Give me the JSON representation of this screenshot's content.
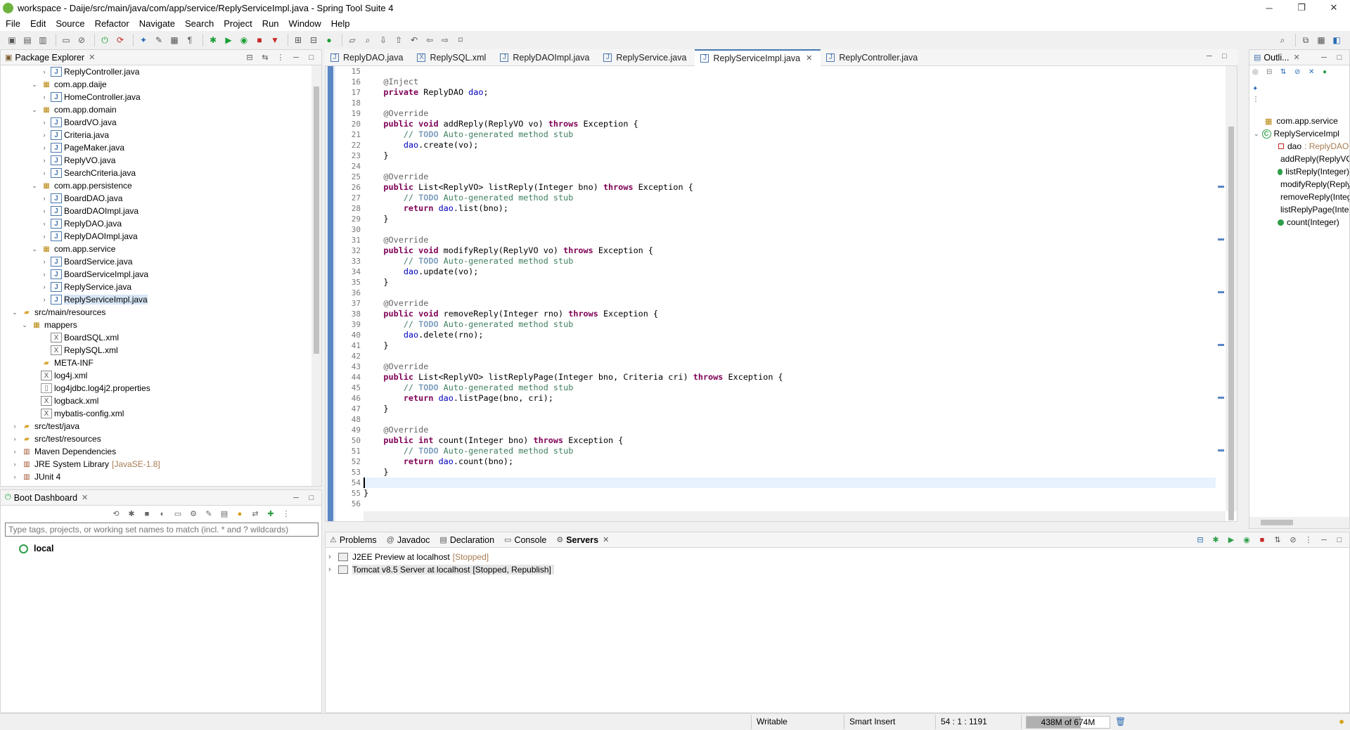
{
  "window": {
    "title": "workspace - Daije/src/main/java/com/app/service/ReplyServiceImpl.java - Spring Tool Suite 4",
    "minimize": "─",
    "maximize": "❐",
    "close": "✕"
  },
  "menu": [
    "File",
    "Edit",
    "Source",
    "Refactor",
    "Navigate",
    "Search",
    "Project",
    "Run",
    "Window",
    "Help"
  ],
  "package_explorer": {
    "title": "Package Explorer",
    "items": [
      {
        "indent": 4,
        "twisty": "›",
        "icon": "java",
        "label": "ReplyController.java"
      },
      {
        "indent": 3,
        "twisty": "⌄",
        "icon": "pkg",
        "label": "com.app.daije"
      },
      {
        "indent": 4,
        "twisty": "›",
        "icon": "java",
        "label": "HomeController.java"
      },
      {
        "indent": 3,
        "twisty": "⌄",
        "icon": "pkg",
        "label": "com.app.domain"
      },
      {
        "indent": 4,
        "twisty": "›",
        "icon": "java",
        "label": "BoardVO.java"
      },
      {
        "indent": 4,
        "twisty": "›",
        "icon": "java",
        "label": "Criteria.java"
      },
      {
        "indent": 4,
        "twisty": "›",
        "icon": "java",
        "label": "PageMaker.java"
      },
      {
        "indent": 4,
        "twisty": "›",
        "icon": "java",
        "label": "ReplyVO.java"
      },
      {
        "indent": 4,
        "twisty": "›",
        "icon": "java",
        "label": "SearchCriteria.java"
      },
      {
        "indent": 3,
        "twisty": "⌄",
        "icon": "pkg",
        "label": "com.app.persistence"
      },
      {
        "indent": 4,
        "twisty": "›",
        "icon": "java",
        "label": "BoardDAO.java"
      },
      {
        "indent": 4,
        "twisty": "›",
        "icon": "java",
        "label": "BoardDAOImpl.java"
      },
      {
        "indent": 4,
        "twisty": "›",
        "icon": "java",
        "label": "ReplyDAO.java"
      },
      {
        "indent": 4,
        "twisty": "›",
        "icon": "java",
        "label": "ReplyDAOImpl.java"
      },
      {
        "indent": 3,
        "twisty": "⌄",
        "icon": "pkg",
        "label": "com.app.service"
      },
      {
        "indent": 4,
        "twisty": "›",
        "icon": "java",
        "label": "BoardService.java"
      },
      {
        "indent": 4,
        "twisty": "›",
        "icon": "java",
        "label": "BoardServiceImpl.java"
      },
      {
        "indent": 4,
        "twisty": "›",
        "icon": "java",
        "label": "ReplyService.java"
      },
      {
        "indent": 4,
        "twisty": "›",
        "icon": "java",
        "label": "ReplyServiceImpl.java",
        "selected": true
      },
      {
        "indent": 1,
        "twisty": "⌄",
        "icon": "folder",
        "label": "src/main/resources"
      },
      {
        "indent": 2,
        "twisty": "⌄",
        "icon": "pkg",
        "label": "mappers"
      },
      {
        "indent": 4,
        "twisty": "",
        "icon": "xml",
        "label": "BoardSQL.xml"
      },
      {
        "indent": 4,
        "twisty": "",
        "icon": "xml",
        "label": "ReplySQL.xml"
      },
      {
        "indent": 3,
        "twisty": "",
        "icon": "folder",
        "label": "META-INF"
      },
      {
        "indent": 3,
        "twisty": "",
        "icon": "xml",
        "label": "log4j.xml"
      },
      {
        "indent": 3,
        "twisty": "",
        "icon": "file",
        "label": "log4jdbc.log4j2.properties"
      },
      {
        "indent": 3,
        "twisty": "",
        "icon": "xml",
        "label": "logback.xml"
      },
      {
        "indent": 3,
        "twisty": "",
        "icon": "xml",
        "label": "mybatis-config.xml"
      },
      {
        "indent": 1,
        "twisty": "›",
        "icon": "folder",
        "label": "src/test/java"
      },
      {
        "indent": 1,
        "twisty": "›",
        "icon": "folder",
        "label": "src/test/resources"
      },
      {
        "indent": 1,
        "twisty": "›",
        "icon": "lib",
        "label": "Maven Dependencies"
      },
      {
        "indent": 1,
        "twisty": "›",
        "icon": "lib",
        "label": "JRE System Library",
        "decoration": "[JavaSE-1.8]"
      },
      {
        "indent": 1,
        "twisty": "›",
        "icon": "lib",
        "label": "JUnit 4"
      }
    ]
  },
  "editor_tabs": [
    {
      "label": "ReplyDAO.java",
      "type": "java"
    },
    {
      "label": "ReplySQL.xml",
      "type": "xml"
    },
    {
      "label": "ReplyDAOImpl.java",
      "type": "java"
    },
    {
      "label": "ReplyService.java",
      "type": "java"
    },
    {
      "label": "ReplyServiceImpl.java",
      "type": "java",
      "active": true
    },
    {
      "label": "ReplyController.java",
      "type": "java"
    }
  ],
  "editor": {
    "lines": [
      {
        "n": "15",
        "html": ""
      },
      {
        "n": "16",
        "fold": true,
        "html": "    <span class='ann'>@Inject</span>"
      },
      {
        "n": "17",
        "html": "    <span class='kw'>private</span> ReplyDAO <span class='fld'>dao</span>;"
      },
      {
        "n": "18",
        "html": ""
      },
      {
        "n": "19",
        "fold": true,
        "html": "    <span class='ann'>@Override</span>"
      },
      {
        "n": "20",
        "html": "    <span class='kw'>public void</span> addReply(ReplyVO vo) <span class='kw'>throws</span> Exception {"
      },
      {
        "n": "21",
        "html": "        <span class='cmt'>// <span class='todo'>TODO</span> Auto-generated method stub</span>"
      },
      {
        "n": "22",
        "html": "        <span class='fld'>dao</span>.create(vo);"
      },
      {
        "n": "23",
        "html": "    }"
      },
      {
        "n": "24",
        "html": ""
      },
      {
        "n": "25",
        "fold": true,
        "html": "    <span class='ann'>@Override</span>"
      },
      {
        "n": "26",
        "html": "    <span class='kw'>public</span> List&lt;ReplyVO&gt; listReply(Integer bno) <span class='kw'>throws</span> Exception {"
      },
      {
        "n": "27",
        "html": "        <span class='cmt'>// <span class='todo'>TODO</span> Auto-generated method stub</span>"
      },
      {
        "n": "28",
        "html": "        <span class='kw'>return</span> <span class='fld'>dao</span>.list(bno);"
      },
      {
        "n": "29",
        "html": "    }"
      },
      {
        "n": "30",
        "html": ""
      },
      {
        "n": "31",
        "fold": true,
        "html": "    <span class='ann'>@Override</span>"
      },
      {
        "n": "32",
        "html": "    <span class='kw'>public void</span> modifyReply(ReplyVO vo) <span class='kw'>throws</span> Exception {"
      },
      {
        "n": "33",
        "html": "        <span class='cmt'>// <span class='todo'>TODO</span> Auto-generated method stub</span>"
      },
      {
        "n": "34",
        "html": "        <span class='fld'>dao</span>.update(vo);"
      },
      {
        "n": "35",
        "html": "    }"
      },
      {
        "n": "36",
        "html": ""
      },
      {
        "n": "37",
        "fold": true,
        "html": "    <span class='ann'>@Override</span>"
      },
      {
        "n": "38",
        "html": "    <span class='kw'>public void</span> removeReply(Integer rno) <span class='kw'>throws</span> Exception {"
      },
      {
        "n": "39",
        "html": "        <span class='cmt'>// <span class='todo'>TODO</span> Auto-generated method stub</span>"
      },
      {
        "n": "40",
        "html": "        <span class='fld'>dao</span>.delete(rno);"
      },
      {
        "n": "41",
        "html": "    }"
      },
      {
        "n": "42",
        "html": ""
      },
      {
        "n": "43",
        "fold": true,
        "html": "    <span class='ann'>@Override</span>"
      },
      {
        "n": "44",
        "html": "    <span class='kw'>public</span> List&lt;ReplyVO&gt; listReplyPage(Integer bno, Criteria cri) <span class='kw'>throws</span> Exception {"
      },
      {
        "n": "45",
        "html": "        <span class='cmt'>// <span class='todo'>TODO</span> Auto-generated method stub</span>"
      },
      {
        "n": "46",
        "html": "        <span class='kw'>return</span> <span class='fld'>dao</span>.listPage(bno, cri);"
      },
      {
        "n": "47",
        "html": "    }"
      },
      {
        "n": "48",
        "html": ""
      },
      {
        "n": "49",
        "fold": true,
        "html": "    <span class='ann'>@Override</span>"
      },
      {
        "n": "50",
        "html": "    <span class='kw'>public int</span> count(Integer bno) <span class='kw'>throws</span> Exception {"
      },
      {
        "n": "51",
        "html": "        <span class='cmt'>// <span class='todo'>TODO</span> Auto-generated method stub</span>"
      },
      {
        "n": "52",
        "html": "        <span class='kw'>return</span> <span class='fld'>dao</span>.count(bno);"
      },
      {
        "n": "53",
        "html": "    }"
      },
      {
        "n": "54",
        "current": true,
        "html": ""
      },
      {
        "n": "55",
        "html": "}"
      },
      {
        "n": "56",
        "html": ""
      }
    ]
  },
  "outline": {
    "title": "Outli...",
    "items": [
      {
        "kind": "pkg",
        "label": "com.app.service"
      },
      {
        "kind": "class",
        "label": "ReplyServiceImpl"
      },
      {
        "kind": "field",
        "label": "dao",
        "type": ": ReplyDAO"
      },
      {
        "kind": "method",
        "label": "addReply(ReplyVO)"
      },
      {
        "kind": "method",
        "label": "listReply(Integer)"
      },
      {
        "kind": "method",
        "label": "modifyReply(ReplyVO)"
      },
      {
        "kind": "method",
        "label": "removeReply(Integer)"
      },
      {
        "kind": "method",
        "label": "listReplyPage(Integer, Criteria)"
      },
      {
        "kind": "method",
        "label": "count(Integer)"
      }
    ]
  },
  "boot_dashboard": {
    "title": "Boot Dashboard",
    "filter_placeholder": "Type tags, projects, or working set names to match (incl. * and ? wildcards)",
    "local": "local"
  },
  "bottom_panel": {
    "tabs": [
      {
        "label": "Problems",
        "icon": "⚠"
      },
      {
        "label": "Javadoc",
        "icon": "@"
      },
      {
        "label": "Declaration",
        "icon": "▤"
      },
      {
        "label": "Console",
        "icon": "▭"
      },
      {
        "label": "Servers",
        "icon": "⚙",
        "active": true
      }
    ],
    "servers": [
      {
        "name": "J2EE Preview at localhost",
        "state": "[Stopped]"
      },
      {
        "name": "Tomcat v8.5 Server at localhost",
        "state": "[Stopped, Republish]",
        "selected": true
      }
    ]
  },
  "status": {
    "writable": "Writable",
    "insert_mode": "Smart Insert",
    "position": "54 : 1 : 1191",
    "heap": "438M of 674M",
    "heap_used_fraction": 0.65
  }
}
